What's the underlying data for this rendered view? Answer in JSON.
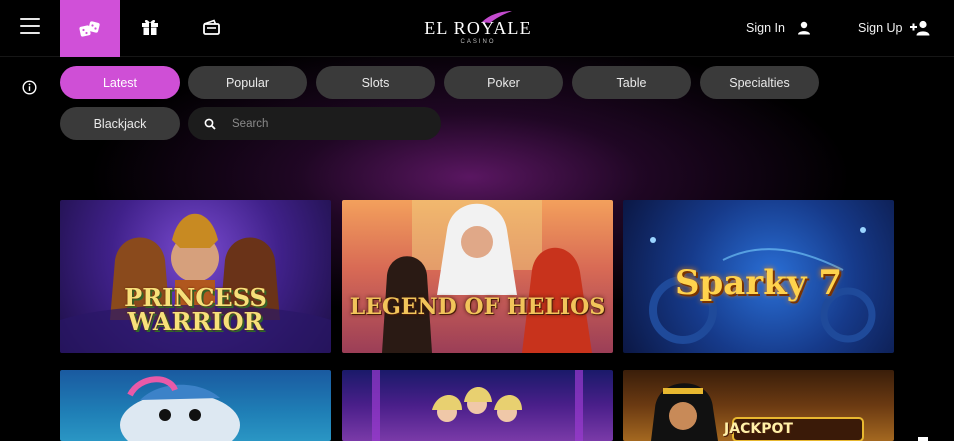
{
  "header": {
    "logo_text": "EL ROYALE",
    "logo_subtext": "CASINO",
    "sign_in_label": "Sign In",
    "sign_up_label": "Sign Up"
  },
  "icons": {
    "menu": "hamburger-icon",
    "games": "dice-icon",
    "promotions": "gift-icon",
    "cashier": "wallet-icon",
    "info": "info-icon",
    "search": "search-icon",
    "sign_in": "user-icon",
    "sign_up": "user-plus-icon"
  },
  "colors": {
    "accent": "#cf4fd6",
    "pill_bg": "#3a3a3a",
    "background": "#000000"
  },
  "filters": [
    {
      "label": "Latest",
      "active": true
    },
    {
      "label": "Popular",
      "active": false
    },
    {
      "label": "Slots",
      "active": false
    },
    {
      "label": "Poker",
      "active": false
    },
    {
      "label": "Table",
      "active": false
    },
    {
      "label": "Specialties",
      "active": false
    },
    {
      "label": "Blackjack",
      "active": false
    }
  ],
  "search": {
    "placeholder": "Search",
    "value": ""
  },
  "games": [
    {
      "title": "PRINCESS WARRIOR"
    },
    {
      "title": "LEGEND OF HELIOS"
    },
    {
      "title": "Sparky 7"
    },
    {
      "title": ""
    },
    {
      "title": ""
    },
    {
      "title": "JACKPOT"
    }
  ]
}
